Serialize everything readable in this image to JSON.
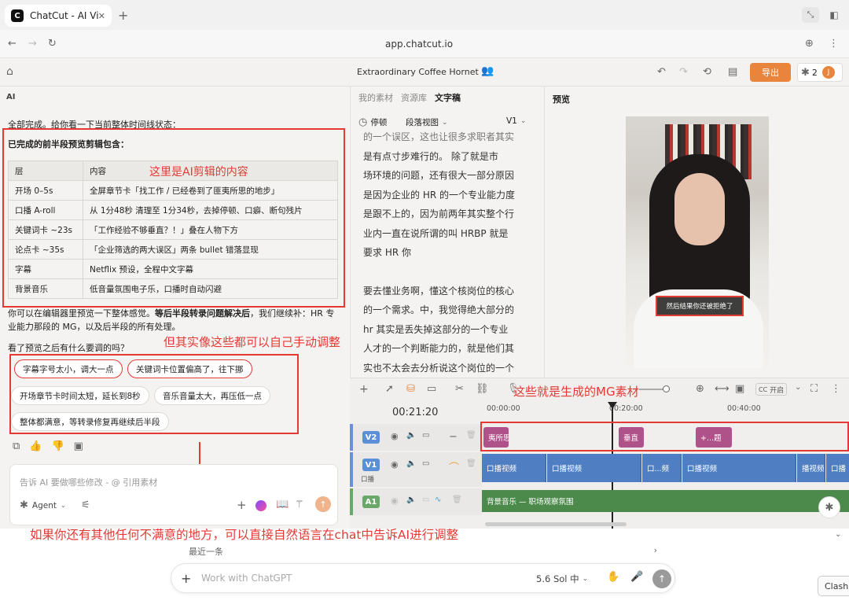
{
  "browser": {
    "tab_title": "ChatCut - AI Vic",
    "url": "app.chatcut.io"
  },
  "app": {
    "project_name": "Extraordinary Coffee Hornet",
    "export_label": "导出",
    "collab_count": "2",
    "avatar_letter": "J",
    "accent_color": "#e8843c"
  },
  "chat": {
    "header": "AI",
    "intro": "全部完成。给你看一下当前整体时间线状态：",
    "summary_title": "已完成的前半段预览剪辑包含：",
    "table": {
      "headers": [
        "层",
        "内容"
      ],
      "rows": [
        [
          "开场 0–5s",
          "全屏章节卡「找工作 / 已经卷到了匪夷所思的地步」"
        ],
        [
          "口播 A-roll",
          "从 1分48秒 清理至 1分34秒，去掉停顿、口癖、断句残片"
        ],
        [
          "关键词卡 ~23s",
          "「工作经验不够垂直？！」叠在人物下方"
        ],
        [
          "论点卡 ~35s",
          "「企业筛选的两大误区」两条 bullet 错落显现"
        ],
        [
          "字幕",
          "Netflix 预设，全程中文字幕"
        ],
        [
          "背景音乐",
          "低音量氛围电子乐，口播时自动闪避"
        ]
      ]
    },
    "para1_a": "你可以在编辑器里预览一下整体感觉。",
    "para1_b": "等后半段转录问题解决后",
    "para1_c": "，我们继续补：HR 专业能力那段的 MG，以及后半段的所有处理。",
    "question": "看了预览之后有什么要调的吗？",
    "chips": [
      "字幕字号太小，调大一点",
      "关键词卡位置偏高了，往下挪",
      "开场章节卡时间太短，延长到8秒",
      "音乐音量太大，再压低一点",
      "整体都满意，等转录修复再继续后半段"
    ],
    "input_placeholder": "告诉 AI 要做哪些修改 - @ 引用素材",
    "agent_label": "Agent"
  },
  "script_panel": {
    "tabs": [
      "我的素材",
      "资源库",
      "文字稿"
    ],
    "active_tab": "文字稿",
    "pause_label": "停顿",
    "view_label": "段落视图",
    "version": "V1",
    "lines_top": [
      "的一个误区，这也让很多求职者其实",
      "是有点寸步难行的。  除了就是市",
      "场环境的问题，还有很大一部分原因",
      "是因为企业的 HR 的一个专业能力度",
      "是跟不上的，因为前两年其实整个行",
      "业内一直在说所谓的叫 HRBP 就是",
      "要求 HR 你"
    ],
    "lines_bottom": [
      "要去懂业务啊，懂这个核岗位的核心",
      "的一个需求。中，我觉得绝大部分的",
      "hr 其实是丢失掉这部分的一个专业",
      "人才的一个判断能力的，就是他们其",
      "实也不太会去分析说这个岗位的一个"
    ]
  },
  "preview": {
    "header": "预览",
    "subtitle": "然后结果你还被拒绝了"
  },
  "timeline": {
    "timecode": "00:21:20",
    "ruler": [
      "00:00:00",
      "00:20:00",
      "00:40:00"
    ],
    "toggle_label": "开启",
    "tracks": [
      {
        "id": "V2",
        "color": "#5b8fd6"
      },
      {
        "id": "V1",
        "color": "#5b8fd6",
        "sub": "口播"
      },
      {
        "id": "A1",
        "color": "#6aa86a"
      }
    ],
    "v2_clips": [
      "夷所思",
      "垂直",
      "+...题"
    ],
    "v1_clips": [
      "口播视频",
      "口播视频",
      "口...频",
      "口播视频",
      "播视频",
      "口播"
    ],
    "a1_clip": "背景音乐 — 职场观察氛围"
  },
  "annotations": {
    "ai_content": "这里是AI剪辑的内容",
    "manual": "但其实像这些都可以自己手动调整",
    "mg": "这些就是生成的MG素材",
    "natural": "如果你还有其他任何不满意的地方，可以直接自然语言在chat中告诉AI进行调整",
    "color": "#e53935"
  },
  "chatgpt_bar": {
    "recent": "最近一条",
    "placeholder": "Work with ChatGPT",
    "model": "5.6 Sol 中",
    "side_button": "Clash"
  }
}
